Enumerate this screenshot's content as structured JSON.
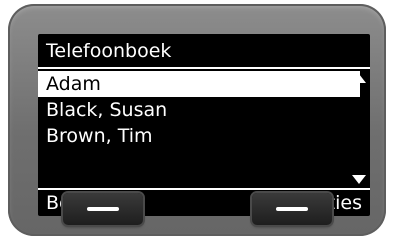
{
  "screen": {
    "title": "Telefoonboek",
    "entries": [
      "Adam",
      "Black, Susan",
      "Brown, Tim"
    ],
    "selected_index": 0,
    "scroll_up_icon": "triangle-up-icon",
    "scroll_down_icon": "triangle-down-icon"
  },
  "softkeys": {
    "left_label": "Bekijken",
    "right_label": "Opties"
  },
  "colors": {
    "screen_background": "#000000",
    "screen_text": "#ffffff",
    "selection_background": "#ffffff",
    "selection_text": "#000000",
    "device_body": "#7a7a7a",
    "hardware_key": "#2a2a2a"
  }
}
